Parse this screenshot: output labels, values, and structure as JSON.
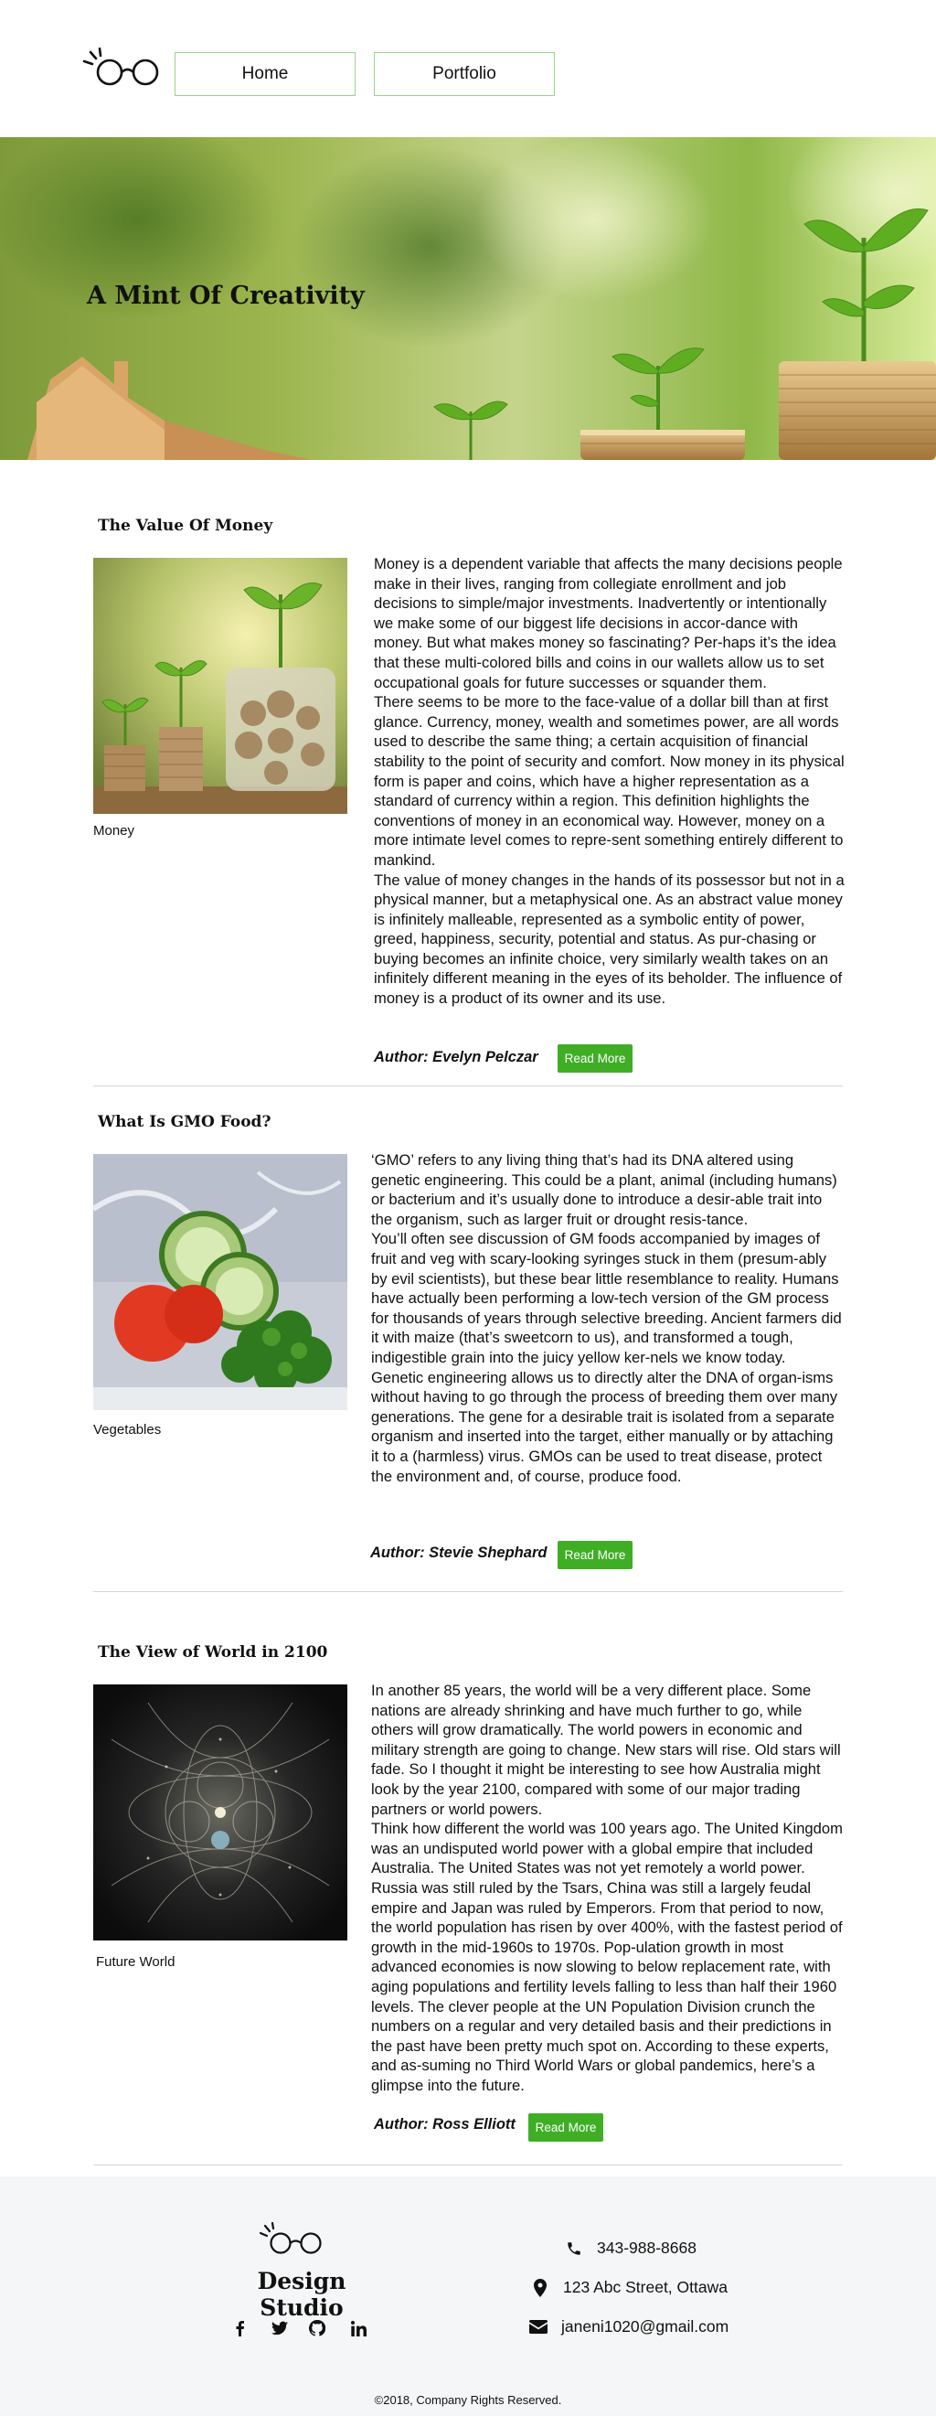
{
  "header": {
    "nav": [
      {
        "label": "Home"
      },
      {
        "label": "Portfolio"
      }
    ]
  },
  "hero": {
    "title": "A Mint Of Creativity"
  },
  "articles": [
    {
      "title": "The Value Of Money",
      "caption": "Money",
      "paragraphs": [
        "Money is a dependent variable that affects the many decisions people make in their lives, ranging from collegiate enrollment and job decisions to simple/major investments. Inadvertently or intentionally we make some of our biggest life decisions in accor-dance with money. But what makes money so fascinating? Per-haps it’s the idea that these multi-colored bills and coins in our wallets allow us to set occupational goals for future successes or squander them.",
        "There seems to be more to the face-value of a dollar bill than at first glance. Currency, money, wealth and sometimes power, are all words used to describe the same thing; a certain acquisition of financial stability to the point of security and comfort. Now money in its physical form is paper and coins, which have a higher representation as a standard of currency within a region. This definition highlights the conventions of money in an economical way. However, money on a more intimate level comes to repre-sent something entirely different to mankind.",
        "The value of money changes in the hands of its possessor but not in a physical manner, but a metaphysical one. As an abstract value money is infinitely malleable, represented as a symbolic entity of power, greed, happiness, security, potential and status. As pur-chasing or buying becomes an infinite choice, very similarly wealth takes on an infinitely different meaning in the eyes of its beholder. The influence of money is a product of its owner and its use."
      ],
      "author": "Author: Evelyn Pelczar",
      "read_more": "Read More"
    },
    {
      "title": "What Is GMO Food?",
      "caption": "Vegetables",
      "paragraphs": [
        "‘GMO’ refers to any living thing that’s had its DNA altered using genetic engineering. This could be a plant, animal (including humans) or bacterium and it’s usually done to introduce a desir-able trait into the organism, such as larger fruit or drought resis-tance.",
        "You’ll often see discussion of GM foods accompanied by images of fruit and veg with scary-looking syringes stuck in them (presum-ably by evil scientists), but these bear little resemblance to reality. Humans have actually been performing a low-tech version of the GM process for thousands of years through selective breeding. Ancient farmers did it with maize (that’s sweetcorn to us), and transformed a tough, indigestible grain into the juicy yellow ker-nels we know today.",
        "Genetic engineering allows us to directly alter the DNA of organ-isms without having to go through the process of breeding them over many generations. The gene for a desirable trait is isolated from a separate organism and inserted into the target, either manually or by attaching it to a (harmless) virus. GMOs can be used to treat disease, protect the environment and, of course, produce food."
      ],
      "author": "Author: Stevie Shephard",
      "read_more": "Read More"
    },
    {
      "title": "The View of World in 2100",
      "caption": "Future World",
      "paragraphs": [
        "In another 85 years, the world will be a very different place. Some nations are already shrinking and have much further to go, while others will grow dramatically. The world powers in economic and military strength are going to change. New stars will rise. Old stars will fade. So I thought it might be interesting to see how Australia might look by the year 2100, compared with some of our major trading partners or world powers.",
        "Think how different the world was 100 years ago. The United Kingdom was an undisputed world power with a global empire that included Australia. The United States was not yet remotely a world power. Russia was still ruled by the Tsars, China was still a largely feudal empire and Japan was ruled by Emperors. From that period to now, the world population has risen by over 400%, with the fastest period of growth in the mid-1960s to 1970s. Pop-ulation growth in most advanced economies is now slowing to below replacement rate, with aging populations and fertility levels falling to less than half their 1960 levels. The clever people at the UN Population Division crunch the numbers on a regular and very detailed basis and their predictions in the past have been pretty much spot on. According to these experts, and as-suming no Third World Wars or global pandemics, here’s a glimpse into the future."
      ],
      "author": "Author: Ross Elliott",
      "read_more": "Read More"
    }
  ],
  "footer": {
    "name": "Design Studio",
    "phone": "343-988-8668",
    "address": "123 Abc Street, Ottawa",
    "email": "janeni1020@gmail.com",
    "copyright": "©2018, Company Rights Reserved.",
    "social_icons": [
      "facebook-icon",
      "twitter-icon",
      "github-icon",
      "linkedin-icon"
    ]
  },
  "colors": {
    "accent": "#3fae25",
    "nav_border": "#9bd38a",
    "footer_bg": "#f5f6f7"
  }
}
